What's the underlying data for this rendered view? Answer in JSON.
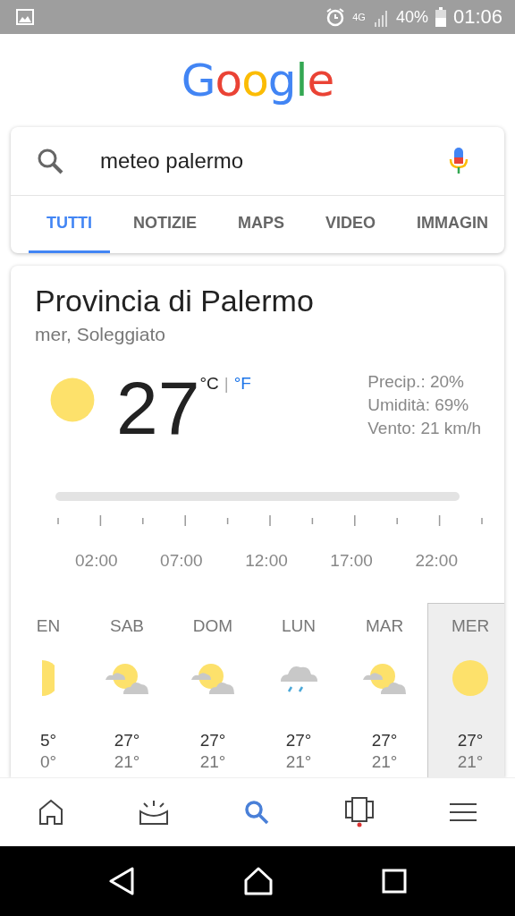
{
  "status_bar": {
    "network": "4G",
    "battery": "40%",
    "time": "01:06"
  },
  "logo": "Google",
  "search": {
    "query": "meteo palermo"
  },
  "tabs": [
    {
      "label": "TUTTI",
      "selected": true
    },
    {
      "label": "NOTIZIE",
      "selected": false
    },
    {
      "label": "MAPS",
      "selected": false
    },
    {
      "label": "VIDEO",
      "selected": false
    },
    {
      "label": "IMMAGIN",
      "selected": false
    }
  ],
  "weather": {
    "location": "Provincia di Palermo",
    "subtitle": "mer, Soleggiato",
    "temperature": "27",
    "unit_c": "°C",
    "separator": "|",
    "unit_f": "°F",
    "details": [
      "Precip.: 20%",
      "Umidità: 69%",
      "Vento: 21 km/h"
    ],
    "times": [
      "02:00",
      "07:00",
      "12:00",
      "17:00",
      "22:00"
    ],
    "days": [
      {
        "day": "EN",
        "kind": "sun",
        "high": "5°",
        "low": "0°",
        "selected": false,
        "partial": true
      },
      {
        "day": "SAB",
        "kind": "partly",
        "high": "27°",
        "low": "21°",
        "selected": false
      },
      {
        "day": "DOM",
        "kind": "partly",
        "high": "27°",
        "low": "21°",
        "selected": false
      },
      {
        "day": "LUN",
        "kind": "rain",
        "high": "27°",
        "low": "21°",
        "selected": false
      },
      {
        "day": "MAR",
        "kind": "partly",
        "high": "27°",
        "low": "21°",
        "selected": false
      },
      {
        "day": "MER",
        "kind": "sun",
        "high": "27°",
        "low": "21°",
        "selected": true
      }
    ]
  }
}
